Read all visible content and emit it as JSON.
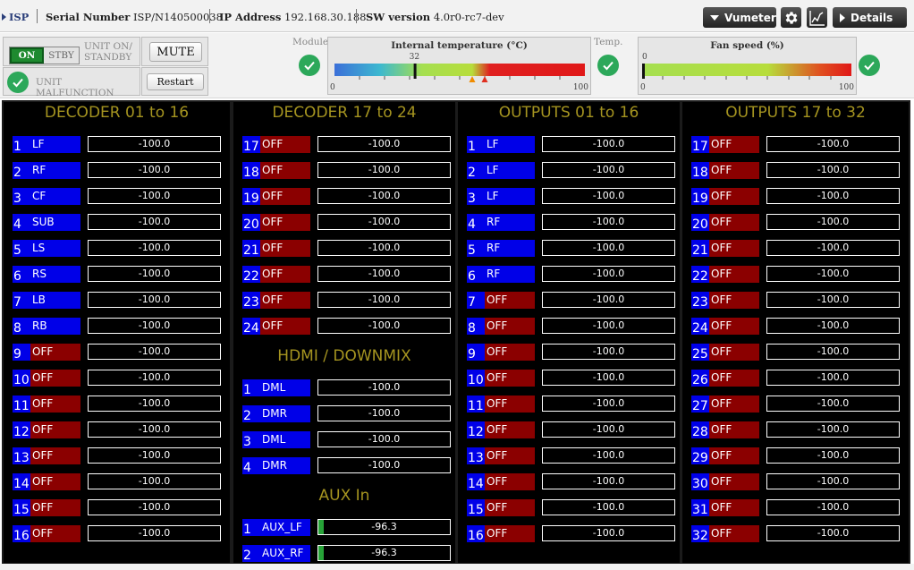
{
  "header": {
    "app_name": "ISP",
    "serial_label": "Serial Number",
    "serial_value": "ISP/N140500038",
    "ip_label": "IP Address",
    "ip_value": "192.168.30.188",
    "sw_label": "SW version",
    "sw_value": "4.0r0-rc7-dev",
    "vumeter_label": "Vumeter",
    "details_label": "Details",
    "icons": [
      "chevron-down-icon",
      "gear-icon",
      "chart-line-icon",
      "chevron-right-icon"
    ]
  },
  "controls": {
    "on_label": "ON",
    "stby_label": "STBY",
    "unit_onstandby_label": [
      "UNIT ON/",
      "STANDBY"
    ],
    "mute_label": "MUTE",
    "malfunction_label": "UNIT MALFUNCTION",
    "restart_label": "Restart",
    "module_label": "Module",
    "temp_label": "Temp.",
    "status_color": "#2ca85a"
  },
  "temperature_gauge": {
    "title": "Internal temperature (°C)",
    "min_label": "0",
    "max_label": "100",
    "value_label": "32",
    "min": 0,
    "max": 100,
    "value": 32,
    "markers": [
      55,
      60
    ],
    "marker_colors": [
      "#f08c00",
      "#e03020"
    ]
  },
  "fan_gauge": {
    "title": "Fan speed (%)",
    "min_label": "0",
    "max_label": "100",
    "value_label": "0",
    "min": 0,
    "max": 100,
    "value": 0
  },
  "colors": {
    "channel_on": "#0000e8",
    "channel_off": "#8b0000",
    "title": "#a59420",
    "level": "#27a338"
  },
  "panels": [
    {
      "sections": [
        {
          "title": "DECODER 01 to 16",
          "rows": [
            {
              "n": "1",
              "label": "LF",
              "state": "on",
              "value": "-100.0",
              "level": 0
            },
            {
              "n": "2",
              "label": "RF",
              "state": "on",
              "value": "-100.0",
              "level": 0
            },
            {
              "n": "3",
              "label": "CF",
              "state": "on",
              "value": "-100.0",
              "level": 0
            },
            {
              "n": "4",
              "label": "SUB",
              "state": "on",
              "value": "-100.0",
              "level": 0
            },
            {
              "n": "5",
              "label": "LS",
              "state": "on",
              "value": "-100.0",
              "level": 0
            },
            {
              "n": "6",
              "label": "RS",
              "state": "on",
              "value": "-100.0",
              "level": 0
            },
            {
              "n": "7",
              "label": "LB",
              "state": "on",
              "value": "-100.0",
              "level": 0
            },
            {
              "n": "8",
              "label": "RB",
              "state": "on",
              "value": "-100.0",
              "level": 0
            },
            {
              "n": "9",
              "label": "OFF",
              "state": "off",
              "value": "-100.0",
              "level": 0
            },
            {
              "n": "10",
              "label": "OFF",
              "state": "off",
              "value": "-100.0",
              "level": 0
            },
            {
              "n": "11",
              "label": "OFF",
              "state": "off",
              "value": "-100.0",
              "level": 0
            },
            {
              "n": "12",
              "label": "OFF",
              "state": "off",
              "value": "-100.0",
              "level": 0
            },
            {
              "n": "13",
              "label": "OFF",
              "state": "off",
              "value": "-100.0",
              "level": 0
            },
            {
              "n": "14",
              "label": "OFF",
              "state": "off",
              "value": "-100.0",
              "level": 0
            },
            {
              "n": "15",
              "label": "OFF",
              "state": "off",
              "value": "-100.0",
              "level": 0
            },
            {
              "n": "16",
              "label": "OFF",
              "state": "off",
              "value": "-100.0",
              "level": 0
            }
          ]
        }
      ]
    },
    {
      "sections": [
        {
          "title": "DECODER 17 to 24",
          "rows": [
            {
              "n": "17",
              "label": "OFF",
              "state": "off",
              "value": "-100.0",
              "level": 0
            },
            {
              "n": "18",
              "label": "OFF",
              "state": "off",
              "value": "-100.0",
              "level": 0
            },
            {
              "n": "19",
              "label": "OFF",
              "state": "off",
              "value": "-100.0",
              "level": 0
            },
            {
              "n": "20",
              "label": "OFF",
              "state": "off",
              "value": "-100.0",
              "level": 0
            },
            {
              "n": "21",
              "label": "OFF",
              "state": "off",
              "value": "-100.0",
              "level": 0
            },
            {
              "n": "22",
              "label": "OFF",
              "state": "off",
              "value": "-100.0",
              "level": 0
            },
            {
              "n": "23",
              "label": "OFF",
              "state": "off",
              "value": "-100.0",
              "level": 0
            },
            {
              "n": "24",
              "label": "OFF",
              "state": "off",
              "value": "-100.0",
              "level": 0
            }
          ]
        },
        {
          "title": "HDMI / DOWNMIX",
          "rows": [
            {
              "n": "1",
              "label": "DML",
              "state": "on",
              "value": "-100.0",
              "level": 0
            },
            {
              "n": "2",
              "label": "DMR",
              "state": "on",
              "value": "-100.0",
              "level": 0
            },
            {
              "n": "3",
              "label": "DML",
              "state": "on",
              "value": "-100.0",
              "level": 0
            },
            {
              "n": "4",
              "label": "DMR",
              "state": "on",
              "value": "-100.0",
              "level": 0
            }
          ]
        },
        {
          "title": "AUX In",
          "rows": [
            {
              "n": "1",
              "label": "AUX_LF",
              "state": "on",
              "value": "-96.3",
              "level": 0.04
            },
            {
              "n": "2",
              "label": "AUX_RF",
              "state": "on",
              "value": "-96.3",
              "level": 0.04
            }
          ]
        }
      ]
    },
    {
      "sections": [
        {
          "title": "OUTPUTS 01 to 16",
          "rows": [
            {
              "n": "1",
              "label": "LF",
              "state": "on",
              "value": "-100.0",
              "level": 0
            },
            {
              "n": "2",
              "label": "LF",
              "state": "on",
              "value": "-100.0",
              "level": 0
            },
            {
              "n": "3",
              "label": "LF",
              "state": "on",
              "value": "-100.0",
              "level": 0
            },
            {
              "n": "4",
              "label": "RF",
              "state": "on",
              "value": "-100.0",
              "level": 0
            },
            {
              "n": "5",
              "label": "RF",
              "state": "on",
              "value": "-100.0",
              "level": 0
            },
            {
              "n": "6",
              "label": "RF",
              "state": "on",
              "value": "-100.0",
              "level": 0
            },
            {
              "n": "7",
              "label": "OFF",
              "state": "off",
              "value": "-100.0",
              "level": 0
            },
            {
              "n": "8",
              "label": "OFF",
              "state": "off",
              "value": "-100.0",
              "level": 0
            },
            {
              "n": "9",
              "label": "OFF",
              "state": "off",
              "value": "-100.0",
              "level": 0
            },
            {
              "n": "10",
              "label": "OFF",
              "state": "off",
              "value": "-100.0",
              "level": 0
            },
            {
              "n": "11",
              "label": "OFF",
              "state": "off",
              "value": "-100.0",
              "level": 0
            },
            {
              "n": "12",
              "label": "OFF",
              "state": "off",
              "value": "-100.0",
              "level": 0
            },
            {
              "n": "13",
              "label": "OFF",
              "state": "off",
              "value": "-100.0",
              "level": 0
            },
            {
              "n": "14",
              "label": "OFF",
              "state": "off",
              "value": "-100.0",
              "level": 0
            },
            {
              "n": "15",
              "label": "OFF",
              "state": "off",
              "value": "-100.0",
              "level": 0
            },
            {
              "n": "16",
              "label": "OFF",
              "state": "off",
              "value": "-100.0",
              "level": 0
            }
          ]
        }
      ]
    },
    {
      "sections": [
        {
          "title": "OUTPUTS 17 to 32",
          "rows": [
            {
              "n": "17",
              "label": "OFF",
              "state": "off",
              "value": "-100.0",
              "level": 0
            },
            {
              "n": "18",
              "label": "OFF",
              "state": "off",
              "value": "-100.0",
              "level": 0
            },
            {
              "n": "19",
              "label": "OFF",
              "state": "off",
              "value": "-100.0",
              "level": 0
            },
            {
              "n": "20",
              "label": "OFF",
              "state": "off",
              "value": "-100.0",
              "level": 0
            },
            {
              "n": "21",
              "label": "OFF",
              "state": "off",
              "value": "-100.0",
              "level": 0
            },
            {
              "n": "22",
              "label": "OFF",
              "state": "off",
              "value": "-100.0",
              "level": 0
            },
            {
              "n": "23",
              "label": "OFF",
              "state": "off",
              "value": "-100.0",
              "level": 0
            },
            {
              "n": "24",
              "label": "OFF",
              "state": "off",
              "value": "-100.0",
              "level": 0
            },
            {
              "n": "25",
              "label": "OFF",
              "state": "off",
              "value": "-100.0",
              "level": 0
            },
            {
              "n": "26",
              "label": "OFF",
              "state": "off",
              "value": "-100.0",
              "level": 0
            },
            {
              "n": "27",
              "label": "OFF",
              "state": "off",
              "value": "-100.0",
              "level": 0
            },
            {
              "n": "28",
              "label": "OFF",
              "state": "off",
              "value": "-100.0",
              "level": 0
            },
            {
              "n": "29",
              "label": "OFF",
              "state": "off",
              "value": "-100.0",
              "level": 0
            },
            {
              "n": "30",
              "label": "OFF",
              "state": "off",
              "value": "-100.0",
              "level": 0
            },
            {
              "n": "31",
              "label": "OFF",
              "state": "off",
              "value": "-100.0",
              "level": 0
            },
            {
              "n": "32",
              "label": "OFF",
              "state": "off",
              "value": "-100.0",
              "level": 0
            }
          ]
        }
      ]
    }
  ]
}
